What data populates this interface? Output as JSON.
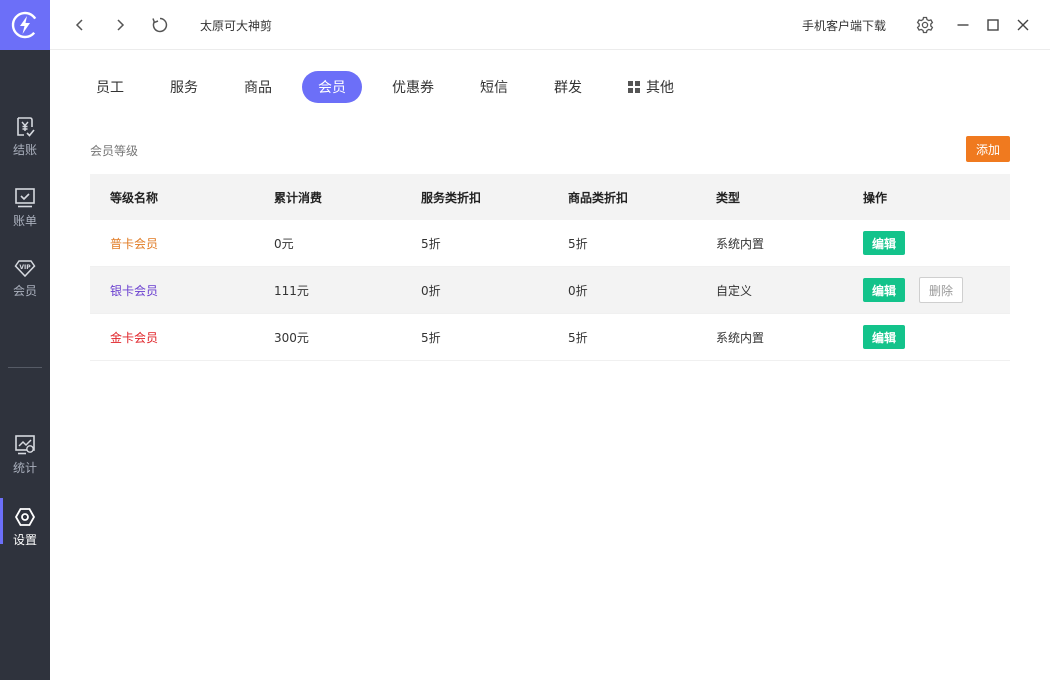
{
  "app": {
    "title": "太原可大神剪",
    "download_label": "手机客户端下载"
  },
  "colors": {
    "accent": "#6c6ff8",
    "sidebar_bg": "#2f333d",
    "add_button": "#f07a1f",
    "edit_button": "#13c38b"
  },
  "sidebar": {
    "items": [
      {
        "label": "结账",
        "icon": "yuan-receipt-icon"
      },
      {
        "label": "账单",
        "icon": "monitor-check-icon"
      },
      {
        "label": "会员",
        "icon": "vip-diamond-icon"
      },
      {
        "label": "统计",
        "icon": "chart-screen-icon"
      },
      {
        "label": "设置",
        "icon": "hexagon-gear-icon",
        "active": true
      }
    ]
  },
  "tabs": [
    {
      "label": "员工"
    },
    {
      "label": "服务"
    },
    {
      "label": "商品"
    },
    {
      "label": "会员",
      "active": true
    },
    {
      "label": "优惠券"
    },
    {
      "label": "短信"
    },
    {
      "label": "群发"
    },
    {
      "label": "其他",
      "icon": "grid-icon"
    }
  ],
  "section": {
    "title": "会员等级",
    "add_label": "添加"
  },
  "table": {
    "headers": [
      "等级名称",
      "累计消费",
      "服务类折扣",
      "商品类折扣",
      "类型",
      "操作"
    ],
    "rows": [
      {
        "name": "普卡会员",
        "name_color": "#e07b24",
        "spend": "0元",
        "service_discount": "5折",
        "product_discount": "5折",
        "type": "系统内置",
        "edit": "编辑"
      },
      {
        "name": "银卡会员",
        "name_color": "#6a3fd0",
        "spend": "111元",
        "service_discount": "0折",
        "product_discount": "0折",
        "type": "自定义",
        "edit": "编辑",
        "delete": "删除"
      },
      {
        "name": "金卡会员",
        "name_color": "#e0242a",
        "spend": "300元",
        "service_discount": "5折",
        "product_discount": "5折",
        "type": "系统内置",
        "edit": "编辑"
      }
    ]
  }
}
